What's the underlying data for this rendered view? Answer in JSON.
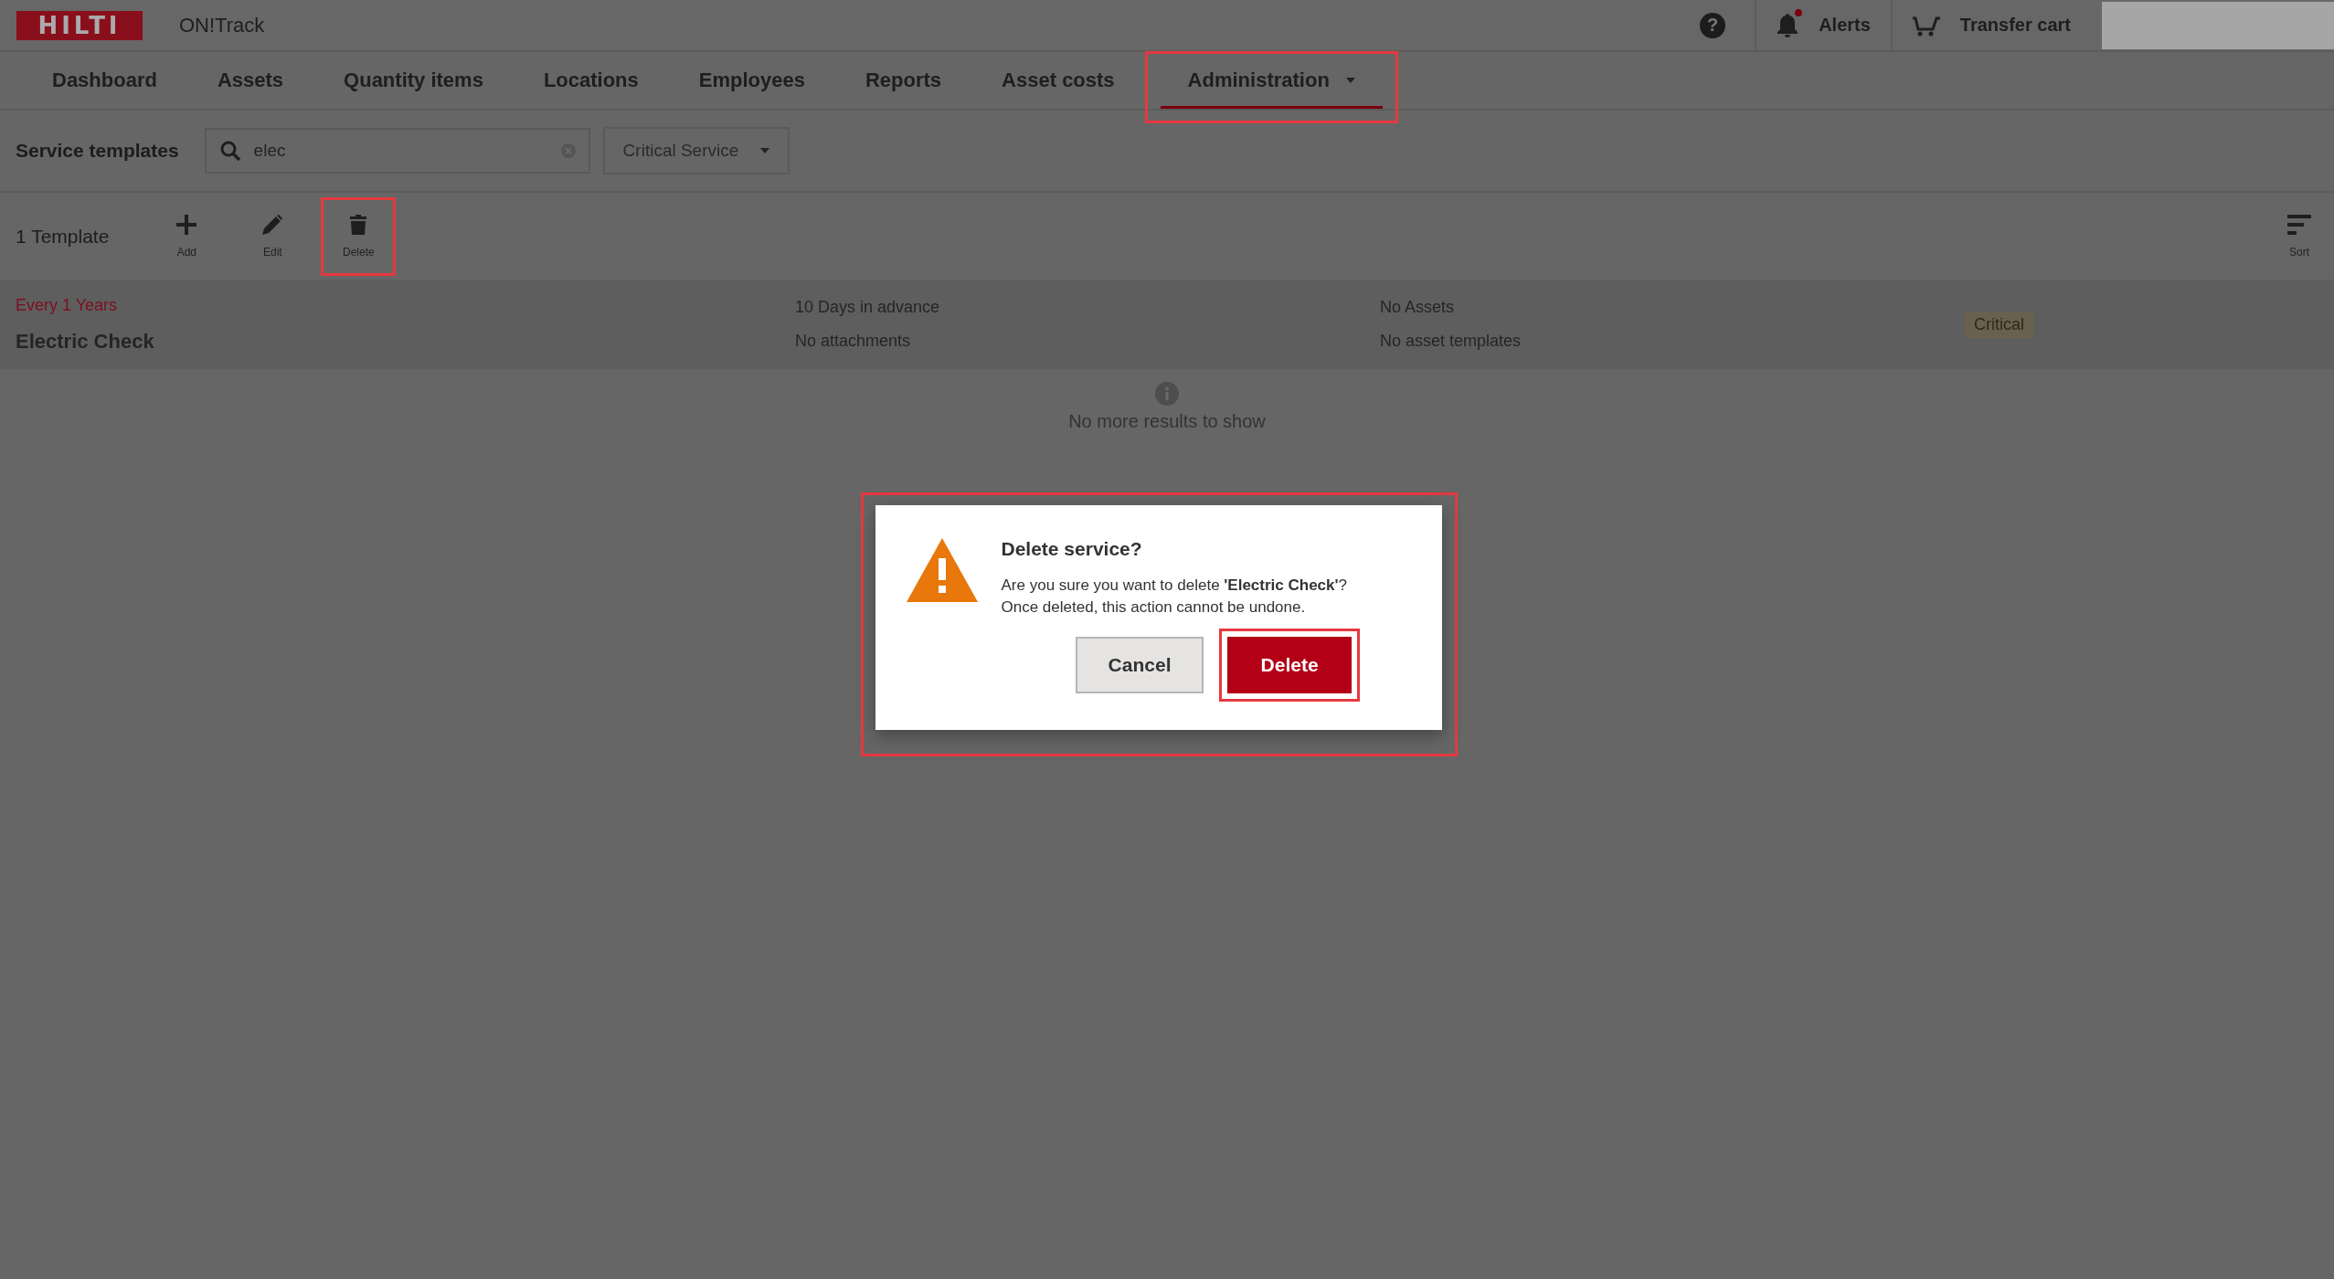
{
  "header": {
    "logo": "HILTI",
    "app_name": "ON!Track",
    "help": "?",
    "alerts": {
      "label": "Alerts",
      "unread": true
    },
    "cart": {
      "label": "Transfer cart"
    }
  },
  "tabs": [
    {
      "label": "Dashboard",
      "selected": false
    },
    {
      "label": "Assets",
      "selected": false
    },
    {
      "label": "Quantity items",
      "selected": false
    },
    {
      "label": "Locations",
      "selected": false
    },
    {
      "label": "Employees",
      "selected": false
    },
    {
      "label": "Reports",
      "selected": false
    },
    {
      "label": "Asset costs",
      "selected": false
    },
    {
      "label": "Administration",
      "selected": true,
      "highlighted": true,
      "dropdown": true
    }
  ],
  "filter_bar": {
    "title": "Service templates",
    "search": {
      "value": "elec"
    },
    "filter": {
      "value": "Critical Service"
    }
  },
  "toolbar": {
    "count": "1 Template",
    "actions": [
      {
        "kind": "add",
        "label": "Add"
      },
      {
        "kind": "edit",
        "label": "Edit"
      },
      {
        "kind": "delete",
        "label": "Delete",
        "highlighted": true
      }
    ],
    "sort": {
      "label": "Sort"
    }
  },
  "rows": [
    {
      "interval": "Every 1 Years",
      "name": "Electric Check",
      "notice": "10 Days in advance",
      "attachments": "No attachments",
      "assets": "No Assets",
      "asset_templates": "No asset templates",
      "badge": "Critical"
    }
  ],
  "end_message": "No more results to show",
  "dialog": {
    "highlighted": true,
    "title": "Delete service?",
    "message": "Are you sure you want to delete **'Electric Check'**?\nOnce deleted, this action cannot be undone.",
    "buttons": [
      {
        "kind": "secondary",
        "label": "Cancel"
      },
      {
        "kind": "primary",
        "label": "Delete",
        "highlighted": true
      }
    ]
  }
}
